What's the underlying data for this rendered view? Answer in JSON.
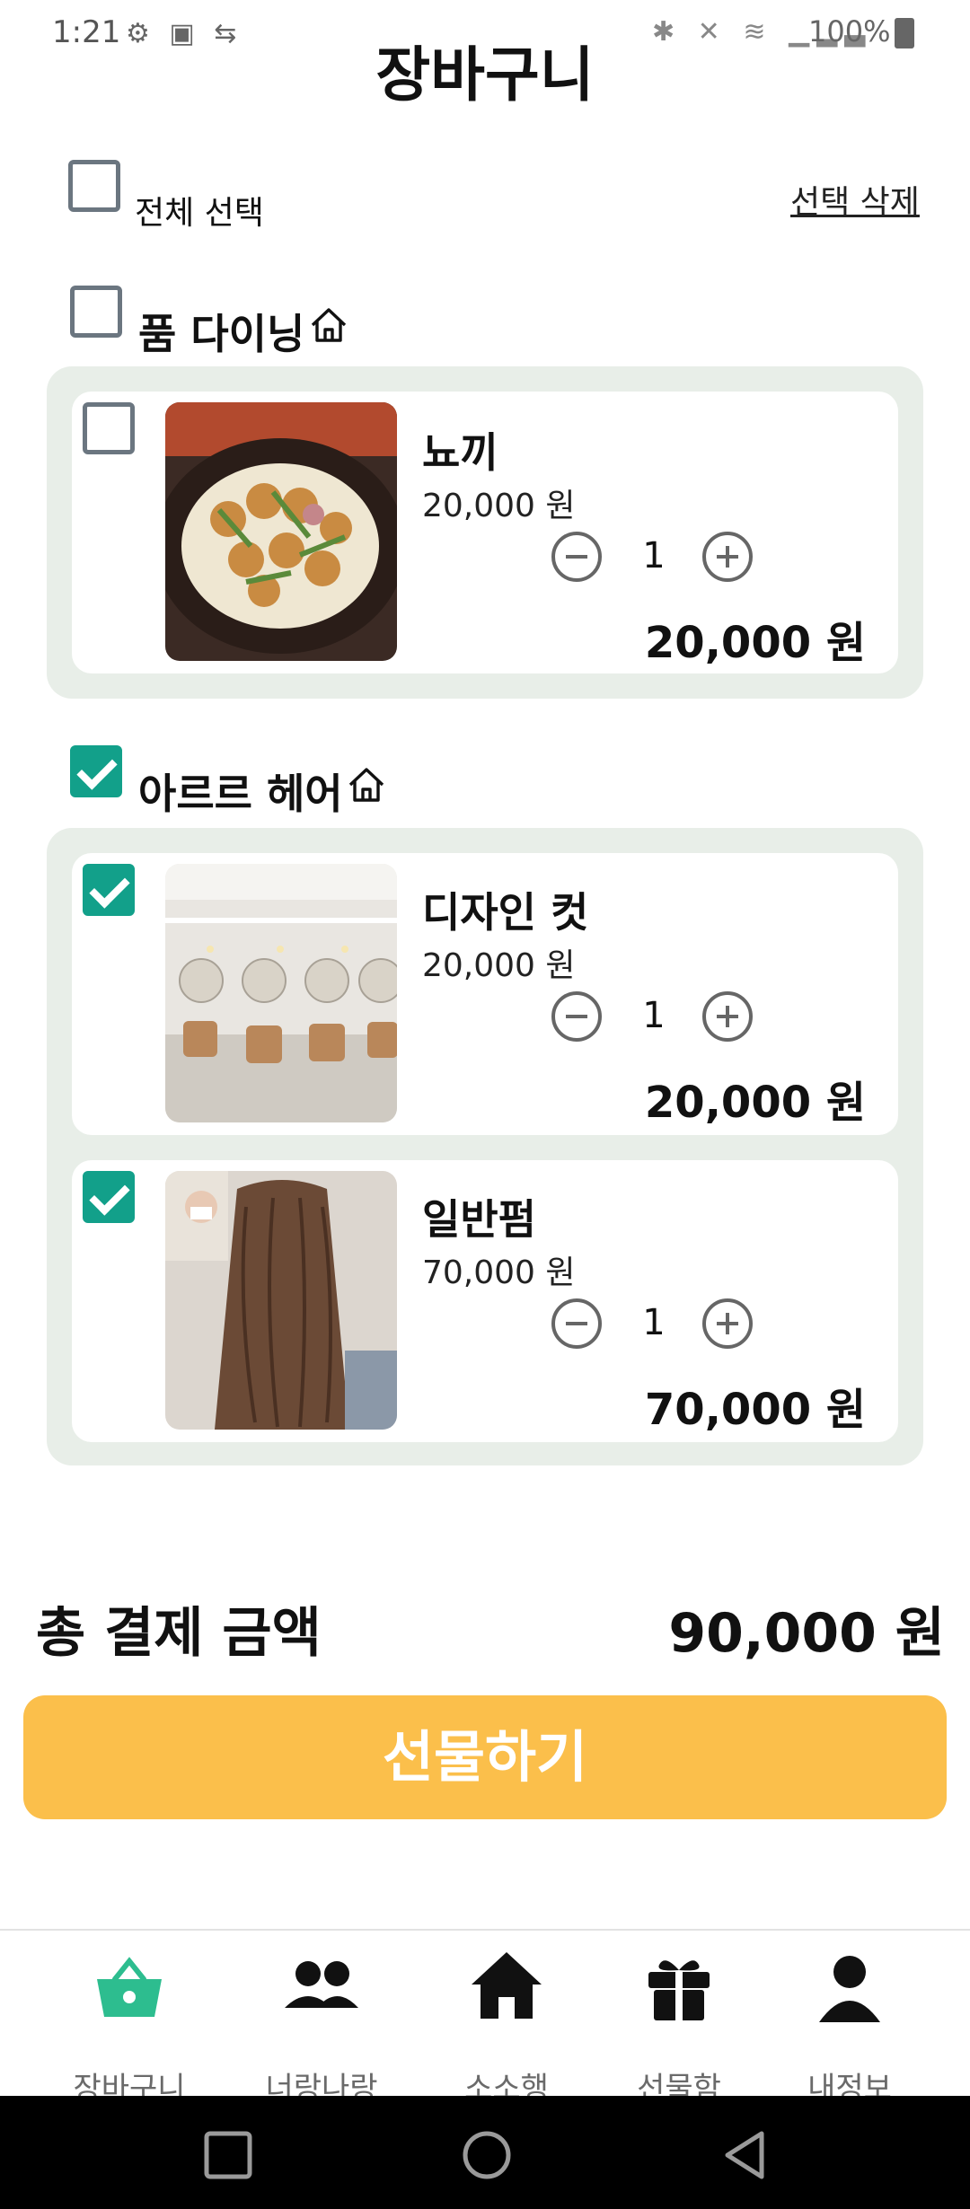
{
  "status_bar": {
    "time": "1:21",
    "left_icons": "⚙ ▣ ⇆",
    "right_icons": "✱ ✕ ≋ ▁▂▃",
    "battery": "100%"
  },
  "header": {
    "title": "장바구니"
  },
  "select_all": {
    "label": "전체 선택",
    "checked": false
  },
  "delete_selected": {
    "label": "선택 삭제"
  },
  "groups": [
    {
      "store": "품 다이닝",
      "checked": false,
      "items": [
        {
          "name": "뇨끼",
          "price": "20,000 원",
          "qty": "1",
          "total": "20,000 원",
          "checked": false
        }
      ]
    },
    {
      "store": "아르르 헤어",
      "checked": true,
      "items": [
        {
          "name": "디자인 컷",
          "price": "20,000 원",
          "qty": "1",
          "total": "20,000 원",
          "checked": true
        },
        {
          "name": "일반펌",
          "price": "70,000 원",
          "qty": "1",
          "total": "70,000 원",
          "checked": true
        }
      ]
    }
  ],
  "summary": {
    "label": "총 결제 금액",
    "value": "90,000 원"
  },
  "gift_button": {
    "label": "선물하기"
  },
  "bottom_nav": [
    {
      "label": "장바구니",
      "icon": "basket-icon",
      "active": true
    },
    {
      "label": "너랑나랑",
      "icon": "people-icon",
      "active": false
    },
    {
      "label": "소소행",
      "icon": "home-icon",
      "active": false
    },
    {
      "label": "선물함",
      "icon": "gift-icon",
      "active": false
    },
    {
      "label": "내정보",
      "icon": "person-icon",
      "active": false
    }
  ],
  "colors": {
    "accent": "#12a08a",
    "gift_button": "#fbbf4b",
    "group_bg": "#e8eee8"
  }
}
